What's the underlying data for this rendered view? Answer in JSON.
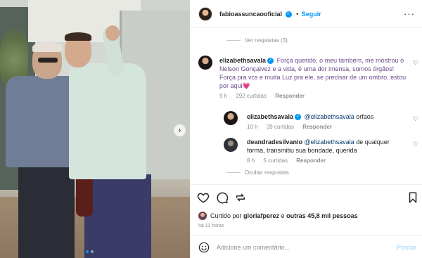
{
  "post": {
    "author": "fabioassuncaooficial",
    "separator": "•",
    "follow_label": "Seguir",
    "more_icon": "more-horizontal-icon"
  },
  "thread": {
    "view_replies_label": "Ver respostas (3)",
    "hide_replies_label": "Ocultar respostas"
  },
  "comments": [
    {
      "username": "elizabethsavala",
      "text": "Força querido, o meu também, me mostrou o Nelson Gonçalvez e a vida, é uma dor imensa, somos órgãos! Força pra vcs e muita Luz pra ele, se precisar de um ombro, estou por aqui",
      "emoji": "💗",
      "time": "9 h",
      "likes": "292 curtidas",
      "reply_label": "Responder"
    },
    {
      "username": "elizabethsavala",
      "mention": "@elizabethsavala",
      "text": "orfaos",
      "time": "10 h",
      "likes": "39 curtidas",
      "reply_label": "Responder"
    },
    {
      "username": "deandradesilvanio",
      "mention": "@elizabethsavala",
      "text": "de qualquer forma, transmitiu sua bondade, querida",
      "time": "8 h",
      "likes": "5 curtidas",
      "reply_label": "Responder"
    }
  ],
  "likes_row": {
    "prefix": "Curtido por",
    "liker": "gloriafperez",
    "connector": "e",
    "others": "outras 45,8 mil pessoas"
  },
  "time_ago": "há 11 horas",
  "add_comment": {
    "placeholder": "Adicione um comentário...",
    "post_label": "Postar"
  },
  "colors": {
    "accent": "#0095f6",
    "muted": "#8e8e8e",
    "text": "#262626",
    "post_disabled": "#b2dffc"
  }
}
